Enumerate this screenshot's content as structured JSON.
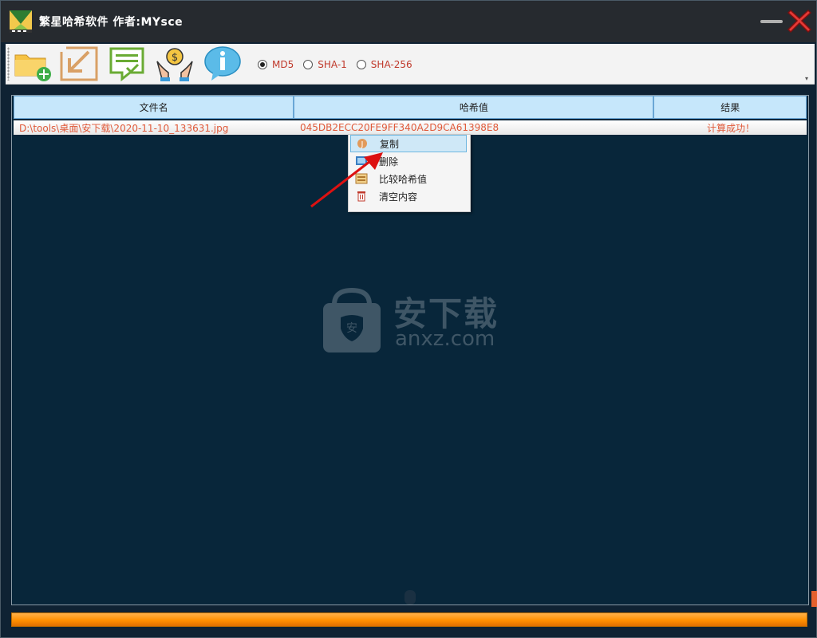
{
  "window": {
    "title": "繁星哈希软件   作者:MYsce",
    "colors": {
      "titlebar": "#262a2f",
      "background": "#08263a",
      "accent": "#ff8f00",
      "text_red": "#e05a3a"
    }
  },
  "toolbar": {
    "buttons": [
      {
        "icon": "add-folder-icon"
      },
      {
        "icon": "import-arrow-icon"
      },
      {
        "icon": "checklist-icon"
      },
      {
        "icon": "hands-coin-icon"
      },
      {
        "icon": "info-icon"
      }
    ],
    "hash_options": [
      {
        "label": "MD5",
        "checked": true
      },
      {
        "label": "SHA-1",
        "checked": false
      },
      {
        "label": "SHA-256",
        "checked": false
      }
    ]
  },
  "table": {
    "columns": [
      "文件名",
      "哈希值",
      "结果"
    ],
    "rows": [
      {
        "file": "D:\\tools\\桌面\\安下载\\2020-11-10_133631.jpg",
        "hash": "045DB2ECC20FE9FF340A2D9CA61398E8",
        "result": "计算成功！"
      }
    ]
  },
  "context_menu": {
    "items": [
      {
        "label": "复制",
        "icon": "copy-icon",
        "highlighted": true
      },
      {
        "label": "删除",
        "icon": "delete-icon",
        "highlighted": false
      },
      {
        "label": "比较哈希值",
        "icon": "compare-icon",
        "highlighted": false
      },
      {
        "label": "清空内容",
        "icon": "clear-icon",
        "highlighted": false
      }
    ]
  },
  "watermark": {
    "cn": "安下载",
    "en": "anxz.com"
  }
}
